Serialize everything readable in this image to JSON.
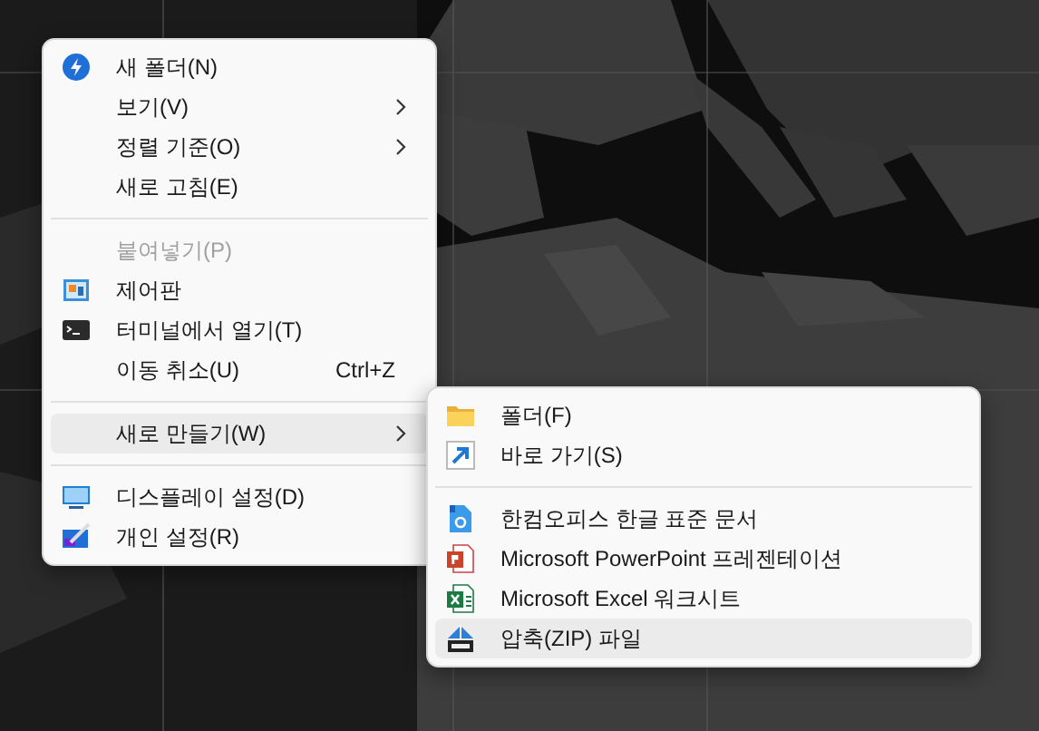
{
  "context_menu": {
    "groups": [
      [
        {
          "label": "새 폴더(N)",
          "has_submenu": false,
          "disabled": false,
          "selected": false
        },
        {
          "label": "보기(V)",
          "has_submenu": true,
          "disabled": false,
          "selected": false
        },
        {
          "label": "정렬 기준(O)",
          "has_submenu": true,
          "disabled": false,
          "selected": false
        },
        {
          "label": "새로 고침(E)",
          "has_submenu": false,
          "disabled": false,
          "selected": false
        }
      ],
      [
        {
          "label": "붙여넣기(P)",
          "has_submenu": false,
          "disabled": true,
          "selected": false
        },
        {
          "label": "제어판",
          "has_submenu": false,
          "disabled": false,
          "selected": false
        },
        {
          "label": "터미널에서 열기(T)",
          "has_submenu": false,
          "disabled": false,
          "selected": false
        },
        {
          "label": "이동 취소(U)",
          "shortcut": "Ctrl+Z",
          "has_submenu": false,
          "disabled": false,
          "selected": false
        }
      ],
      [
        {
          "label": "새로 만들기(W)",
          "has_submenu": true,
          "disabled": false,
          "selected": true
        }
      ],
      [
        {
          "label": "디스플레이 설정(D)",
          "has_submenu": false,
          "disabled": false,
          "selected": false
        },
        {
          "label": "개인 설정(R)",
          "has_submenu": false,
          "disabled": false,
          "selected": false
        }
      ]
    ]
  },
  "submenu": {
    "groups": [
      [
        {
          "label": "폴더(F)",
          "selected": false
        },
        {
          "label": "바로 가기(S)",
          "selected": false
        }
      ],
      [
        {
          "label": "한컴오피스 한글 표준 문서",
          "selected": false
        },
        {
          "label": "Microsoft PowerPoint 프레젠테이션",
          "selected": false
        },
        {
          "label": "Microsoft Excel 워크시트",
          "selected": false
        },
        {
          "label": "압축(ZIP) 파일",
          "selected": true
        }
      ]
    ]
  }
}
